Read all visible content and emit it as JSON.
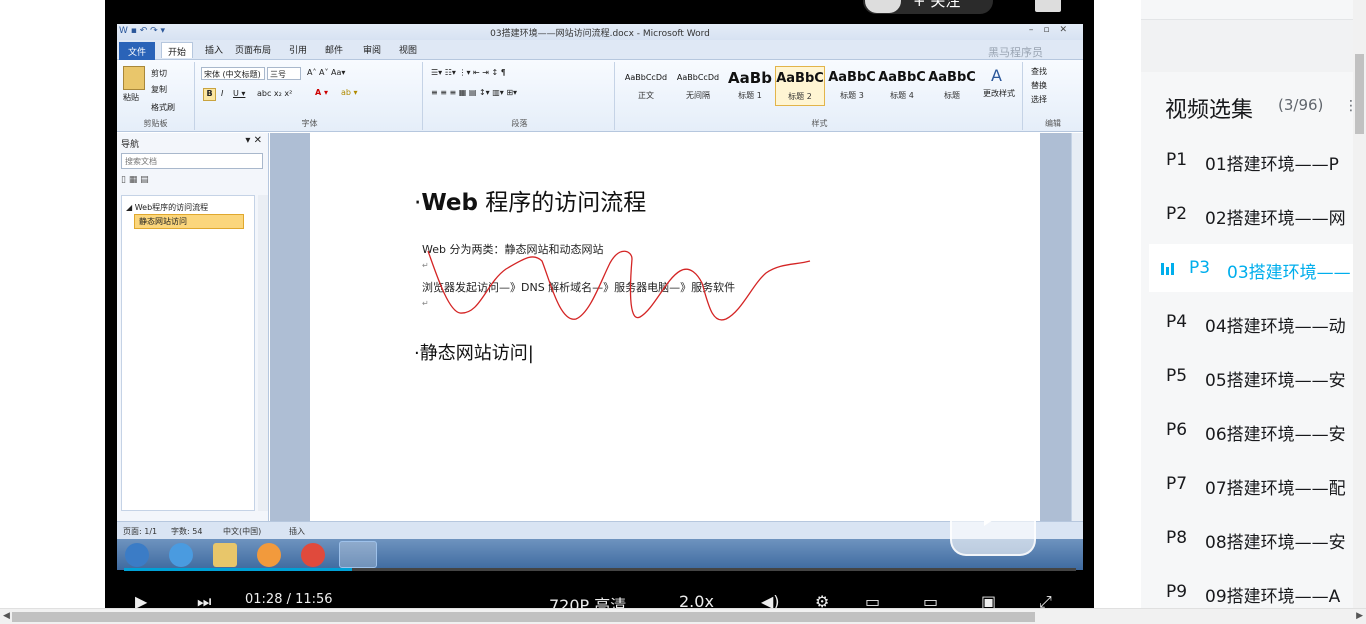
{
  "player": {
    "follow_label": "+ 关注",
    "word": {
      "window_title": "03搭建环境——网站访问流程.docx - Microsoft Word",
      "watermark": "黑马程序员",
      "tabs": [
        "文件",
        "开始",
        "插入",
        "页面布局",
        "引用",
        "邮件",
        "审阅",
        "视图"
      ],
      "clipboard": {
        "paste": "粘贴",
        "cut": "剪切",
        "copy": "复制",
        "format_painter": "格式刷",
        "group": "剪贴板"
      },
      "font": {
        "name": "宋体 (中文标题)",
        "size": "三号",
        "group": "字体"
      },
      "paragraph": {
        "group": "段落"
      },
      "styles": {
        "group": "样式",
        "items": [
          {
            "preview": "AaBbCcDd",
            "name": "正文"
          },
          {
            "preview": "AaBbCcDd",
            "name": "无间隔"
          },
          {
            "preview": "AaBb",
            "name": "标题 1"
          },
          {
            "preview": "AaBbC",
            "name": "标题 2"
          },
          {
            "preview": "AaBbC",
            "name": "标题 3"
          },
          {
            "preview": "AaBbC",
            "name": "标题 4"
          },
          {
            "preview": "AaBbC",
            "name": "标题"
          }
        ],
        "change_styles": "更改样式"
      },
      "editing": {
        "find": "查找",
        "replace": "替换",
        "select": "选择",
        "group": "编辑"
      },
      "nav": {
        "title": "导航",
        "search_placeholder": "搜索文档",
        "nodes": [
          "Web程序的访问流程",
          "静态网站访问"
        ]
      },
      "doc": {
        "heading1_bold": "Web",
        "heading1_rest": " 程序的访问流程",
        "para1": "Web 分为两类：静态网站和动态网站",
        "para2": "浏览器发起访问—》DNS 解析域名—》服务器电脑—》服务软件",
        "heading2": "静态网站访问"
      },
      "status": {
        "page": "页面: 1/1",
        "words": "字数: 54",
        "lang": "中文(中国)",
        "mode": "插入"
      }
    },
    "controls": {
      "time": "01:28 / 11:56",
      "quality": "720P 高清",
      "speed": "2.0x"
    },
    "progress": 0.24
  },
  "sidebar": {
    "title": "视频选集",
    "count": "(3/96)",
    "episodes": [
      {
        "num": "P1",
        "title": "01搭建环境——P"
      },
      {
        "num": "P2",
        "title": "02搭建环境——网"
      },
      {
        "num": "P3",
        "title": "03搭建环境——"
      },
      {
        "num": "P4",
        "title": "04搭建环境——动"
      },
      {
        "num": "P5",
        "title": "05搭建环境——安"
      },
      {
        "num": "P6",
        "title": "06搭建环境——安"
      },
      {
        "num": "P7",
        "title": "07搭建环境——配"
      },
      {
        "num": "P8",
        "title": "08搭建环境——安"
      },
      {
        "num": "P9",
        "title": "09搭建环境——A"
      }
    ],
    "active_index": 2
  }
}
